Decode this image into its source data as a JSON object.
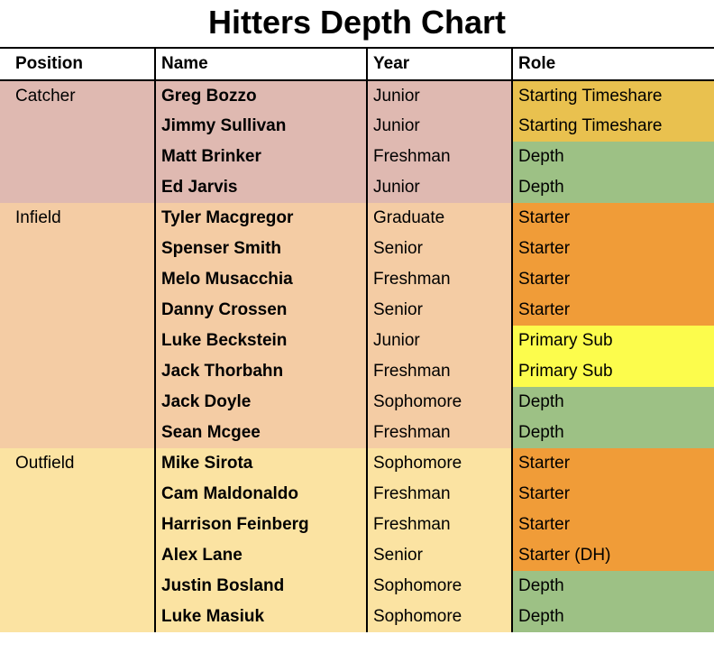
{
  "title": "Hitters Depth Chart",
  "columns": [
    "Position",
    "Name",
    "Year",
    "Role"
  ],
  "colors": {
    "Catcher": "#dfb9b1",
    "Infield": "#f4cca4",
    "Outfield": "#fbe3a2",
    "Starting Timeshare": "#e9c14f",
    "Starter": "#f09c38",
    "Starter (DH)": "#f09c38",
    "Primary Sub": "#fcfc4c",
    "Depth": "#9dc185"
  },
  "groups": [
    {
      "position": "Catcher",
      "players": [
        {
          "name": "Greg Bozzo",
          "year": "Junior",
          "role": "Starting Timeshare"
        },
        {
          "name": "Jimmy Sullivan",
          "year": "Junior",
          "role": "Starting Timeshare"
        },
        {
          "name": "Matt Brinker",
          "year": "Freshman",
          "role": "Depth"
        },
        {
          "name": "Ed Jarvis",
          "year": "Junior",
          "role": "Depth"
        }
      ]
    },
    {
      "position": "Infield",
      "players": [
        {
          "name": "Tyler Macgregor",
          "year": "Graduate",
          "role": "Starter"
        },
        {
          "name": "Spenser Smith",
          "year": "Senior",
          "role": "Starter"
        },
        {
          "name": "Melo Musacchia",
          "year": "Freshman",
          "role": "Starter"
        },
        {
          "name": "Danny Crossen",
          "year": "Senior",
          "role": "Starter"
        },
        {
          "name": "Luke Beckstein",
          "year": "Junior",
          "role": "Primary Sub"
        },
        {
          "name": "Jack Thorbahn",
          "year": "Freshman",
          "role": "Primary Sub"
        },
        {
          "name": "Jack Doyle",
          "year": "Sophomore",
          "role": "Depth"
        },
        {
          "name": "Sean Mcgee",
          "year": "Freshman",
          "role": "Depth"
        }
      ]
    },
    {
      "position": "Outfield",
      "players": [
        {
          "name": "Mike Sirota",
          "year": "Sophomore",
          "role": "Starter"
        },
        {
          "name": "Cam Maldonaldo",
          "year": "Freshman",
          "role": "Starter"
        },
        {
          "name": "Harrison Feinberg",
          "year": "Freshman",
          "role": "Starter"
        },
        {
          "name": "Alex Lane",
          "year": "Senior",
          "role": "Starter (DH)"
        },
        {
          "name": "Justin Bosland",
          "year": "Sophomore",
          "role": "Depth"
        },
        {
          "name": "Luke Masiuk",
          "year": "Sophomore",
          "role": "Depth"
        }
      ]
    }
  ]
}
